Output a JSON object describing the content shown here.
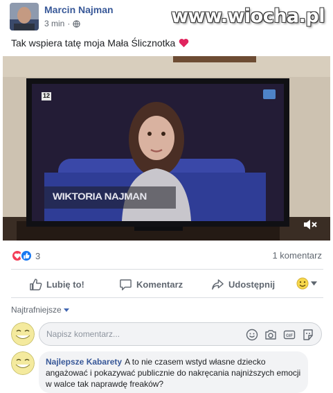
{
  "post": {
    "author": "Marcin Najman",
    "time": "3 min",
    "separator": "·",
    "text": "Tak wspiera tatę moja Mała Ślicznotka"
  },
  "watermark": "www.wiocha.pl",
  "video": {
    "channel_badge": "12",
    "caption": "WIKTORIA NAJMAN"
  },
  "reactions": {
    "count": "3"
  },
  "comments_count": "1 komentarz",
  "actions": {
    "like": "Lubię to!",
    "comment": "Komentarz",
    "share": "Udostępnij"
  },
  "sort_label": "Najtrafniejsze",
  "comment_input": {
    "placeholder": "Napisz komentarz..."
  },
  "comment": {
    "author": "Najlepsze Kabarety",
    "text": "A to nie czasem wstyd własne dziecko angażować i pokazywać publicznie do nakręcania najniższych emocji w walce tak naprawdę freaków?"
  },
  "colors": {
    "link_blue": "#385898",
    "love_red": "#f33e58",
    "like_blue": "#1877f2",
    "muted_gray": "#606770"
  },
  "icons": [
    "globe-icon",
    "heart-icon",
    "mute-icon",
    "like-icon",
    "comment-icon",
    "share-icon",
    "emoji-icon",
    "camera-icon",
    "gif-icon",
    "sticker-icon",
    "chevron-down-icon"
  ]
}
